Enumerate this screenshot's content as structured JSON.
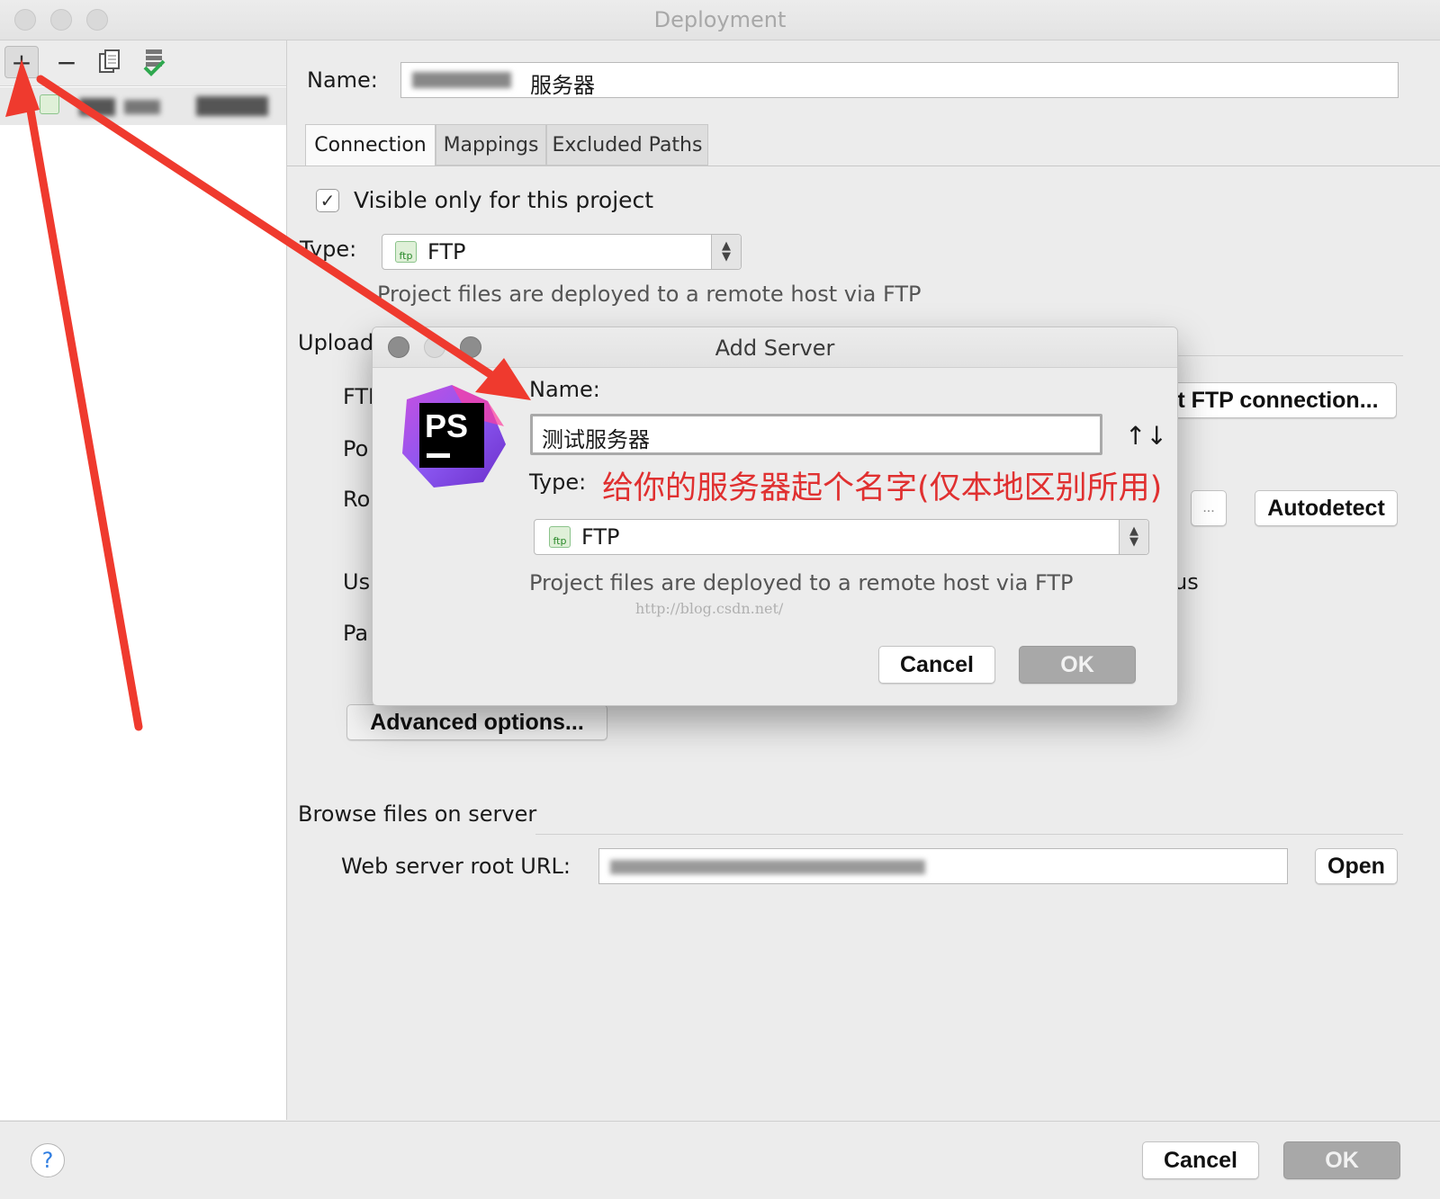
{
  "window": {
    "title": "Deployment"
  },
  "sidebar": {
    "toolbar": {
      "add": "+",
      "remove": "−"
    }
  },
  "main": {
    "name_label": "Name:",
    "name_value": "服务器",
    "tabs": [
      {
        "label": "Connection"
      },
      {
        "label": "Mappings"
      },
      {
        "label": "Excluded Paths"
      }
    ],
    "visible_only_label": "Visible only for this project",
    "type_label": "Type:",
    "type_value": "FTP",
    "ftp_icon_text": "ftp",
    "type_description": "Project files are deployed to a remote host via FTP",
    "upload_section_label": "Upload",
    "partial_labels": {
      "ftp": "FTI",
      "port": "Po",
      "root": "Ro",
      "user": "Us",
      "pass": "Pa",
      "anon": "us"
    },
    "test_connection_button": "st FTP connection...",
    "browse_button": "...",
    "autodetect_button": "Autodetect",
    "advanced_options_button": "Advanced options...",
    "browse_section_label": "Browse files on server",
    "web_root_label": "Web server root URL:",
    "open_button": "Open"
  },
  "footer": {
    "help": "?",
    "cancel": "Cancel",
    "ok": "OK"
  },
  "dialog": {
    "title": "Add Server",
    "logo_text": "PS",
    "name_label": "Name:",
    "name_value": "测试服务器",
    "sort_icon": "↑↓",
    "type_label": "Type:",
    "type_value": "FTP",
    "ftp_icon_text": "ftp",
    "description": "Project files are deployed to a remote host via FTP",
    "annotation": "给你的服务器起个名字(仅本地区别所用)",
    "watermark": "http://blog.csdn.net/",
    "cancel": "Cancel",
    "ok": "OK"
  },
  "colors": {
    "annotation": "#e03030",
    "arrow": "#ef3a2e",
    "window_bg": "#ececec"
  }
}
